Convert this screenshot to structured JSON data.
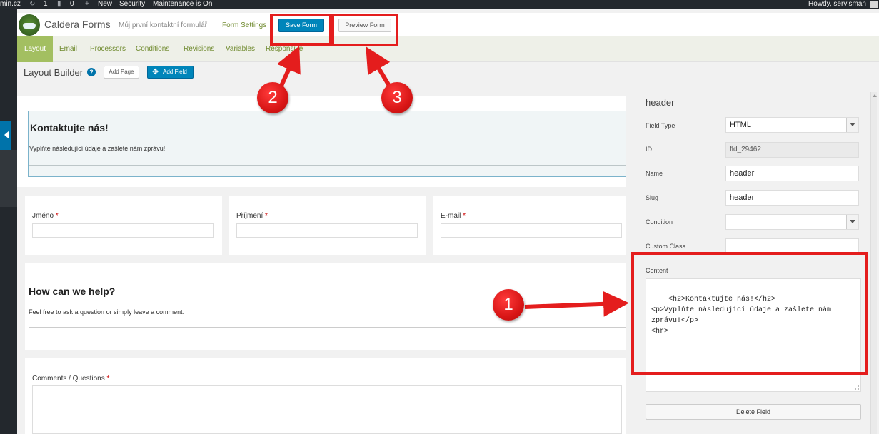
{
  "admin_bar": {
    "site_suffix": "min.cz",
    "updates_count": "1",
    "comments_count": "0",
    "new_label": "New",
    "security_label": "Security",
    "maintenance_label": "Maintenance is On",
    "howdy": "Howdy, servisman"
  },
  "header": {
    "app_title": "Caldera Forms",
    "form_name": "Můj první kontaktní formulář",
    "form_settings": "Form Settings",
    "save_label": "Save Form",
    "preview_label": "Preview Form"
  },
  "tabs": [
    "Layout",
    "Email",
    "Processors",
    "Conditions",
    "Revisions",
    "Variables",
    "Responsive"
  ],
  "active_tab": "Layout",
  "layout_builder": {
    "title": "Layout Builder",
    "help_glyph": "?",
    "add_page": "Add Page",
    "add_field": "Add Field"
  },
  "canvas": {
    "header_field": {
      "heading": "Kontaktujte nás!",
      "text": "Vyplňte následující údaje a zašlete nám zprávu!"
    },
    "fields": [
      {
        "label": "Jméno",
        "required": "*"
      },
      {
        "label": "Příjmení",
        "required": "*"
      },
      {
        "label": "E-mail",
        "required": "*"
      }
    ],
    "help_block": {
      "heading": "How can we help?",
      "text": "Feel free to ask a question or simply leave a comment."
    },
    "comments_field": {
      "label": "Comments / Questions",
      "required": "*"
    }
  },
  "sidebar": {
    "title": "header",
    "field_type_label": "Field Type",
    "field_type_value": "HTML",
    "id_label": "ID",
    "id_value": "fld_29462",
    "name_label": "Name",
    "name_value": "header",
    "slug_label": "Slug",
    "slug_value": "header",
    "condition_label": "Condition",
    "condition_value": "",
    "custom_class_label": "Custom Class",
    "custom_class_value": "",
    "content_label": "Content",
    "content_value": "<h2>Kontaktujte nás!</h2>\n<p>Vyplňte následující údaje a zašlete nám zprávu!</p>\n<hr>",
    "delete_label": "Delete Field"
  },
  "annotations": {
    "badge_1": "1",
    "badge_2": "2",
    "badge_3": "3",
    "color": "#e41d1d"
  },
  "colors": {
    "wp_dark": "#23282d",
    "primary_blue": "#0085ba",
    "caldera_green": "#a3bf61",
    "selected_field_border": "#7bb3cb"
  }
}
